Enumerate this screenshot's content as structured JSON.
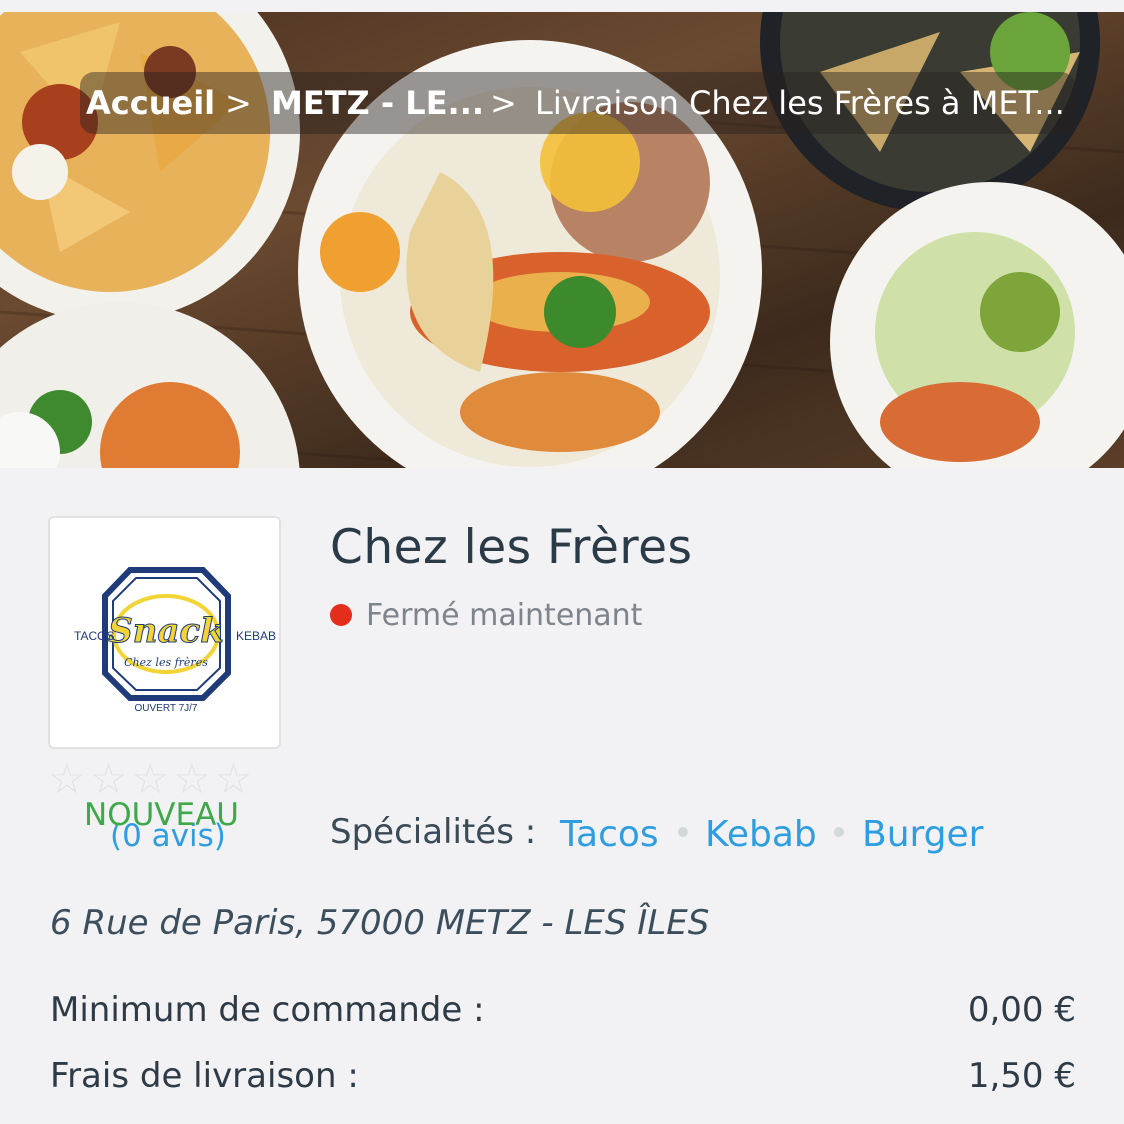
{
  "breadcrumb": {
    "home": "Accueil",
    "city": "METZ - LE...",
    "current": "Livraison Chez les Frères à MET...",
    "separator": ">"
  },
  "logo": {
    "left_text": "TACOS",
    "right_text": "KEBAB",
    "main_text": "Snack",
    "sub_text": "Chez les frères",
    "bottom_text": "OUVERT 7J/7"
  },
  "restaurant": {
    "name": "Chez les Frères",
    "status": "Fermé maintenant",
    "status_color": "#e52d1c"
  },
  "rating": {
    "stars_filled": 0,
    "stars_total": 5,
    "badge": "NOUVEAU",
    "reviews": "(0 avis)"
  },
  "specialties": {
    "label": "Spécialités :",
    "items": [
      "Tacos",
      "Kebab",
      "Burger"
    ]
  },
  "address": "6 Rue de Paris, 57000 METZ - LES ÎLES",
  "order_info": {
    "minimum_label": "Minimum de commande :",
    "minimum_value": "0,00 €",
    "delivery_label": "Frais de livraison :",
    "delivery_value": "1,50 €"
  },
  "colors": {
    "link": "#2e9ee0",
    "new_badge": "#3ea84a",
    "text": "#2e3b46",
    "background": "#f2f2f4"
  }
}
